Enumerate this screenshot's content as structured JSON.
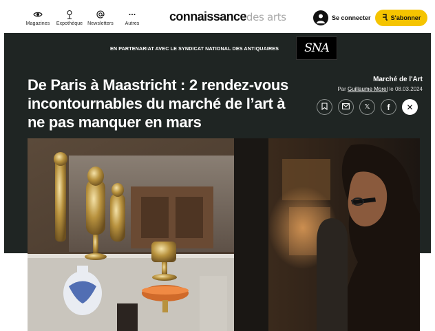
{
  "nav": {
    "items": [
      {
        "label": "Magazines",
        "icon": "eye-icon"
      },
      {
        "label": "Expothèque",
        "icon": "location-pin-icon"
      },
      {
        "label": "Newsletters",
        "icon": "at-sign-icon"
      },
      {
        "label": "Autres",
        "icon": "more-dots-icon"
      }
    ],
    "logo_main": "connaissance",
    "logo_des": "des",
    "logo_arts": "arts",
    "login_label": "Se connecter",
    "subscribe_label": "S'abonner",
    "accent": "#f5c400"
  },
  "hero": {
    "background": "#1f2523",
    "partner_text": "EN PARTENARIAT AVEC LE SYNDICAT NATIONAL DES ANTIQUAIRES",
    "partner_logo": "SNA",
    "title": "De Paris à Maastricht : 2 rendez-vous incontournables du marché de l’art à ne pas manquer en mars",
    "rubric": "Marché de l'Art",
    "byline_prefix": "Par",
    "author": "Guillaume Morel",
    "date_prefix": "le",
    "date": "08.03.2024",
    "share_icons": [
      "bookmark-icon",
      "email-icon",
      "x-twitter-icon",
      "facebook-icon",
      "close-icon"
    ],
    "share_glyphs": {
      "x": "𝕏",
      "facebook": "f",
      "close": "✕"
    }
  }
}
